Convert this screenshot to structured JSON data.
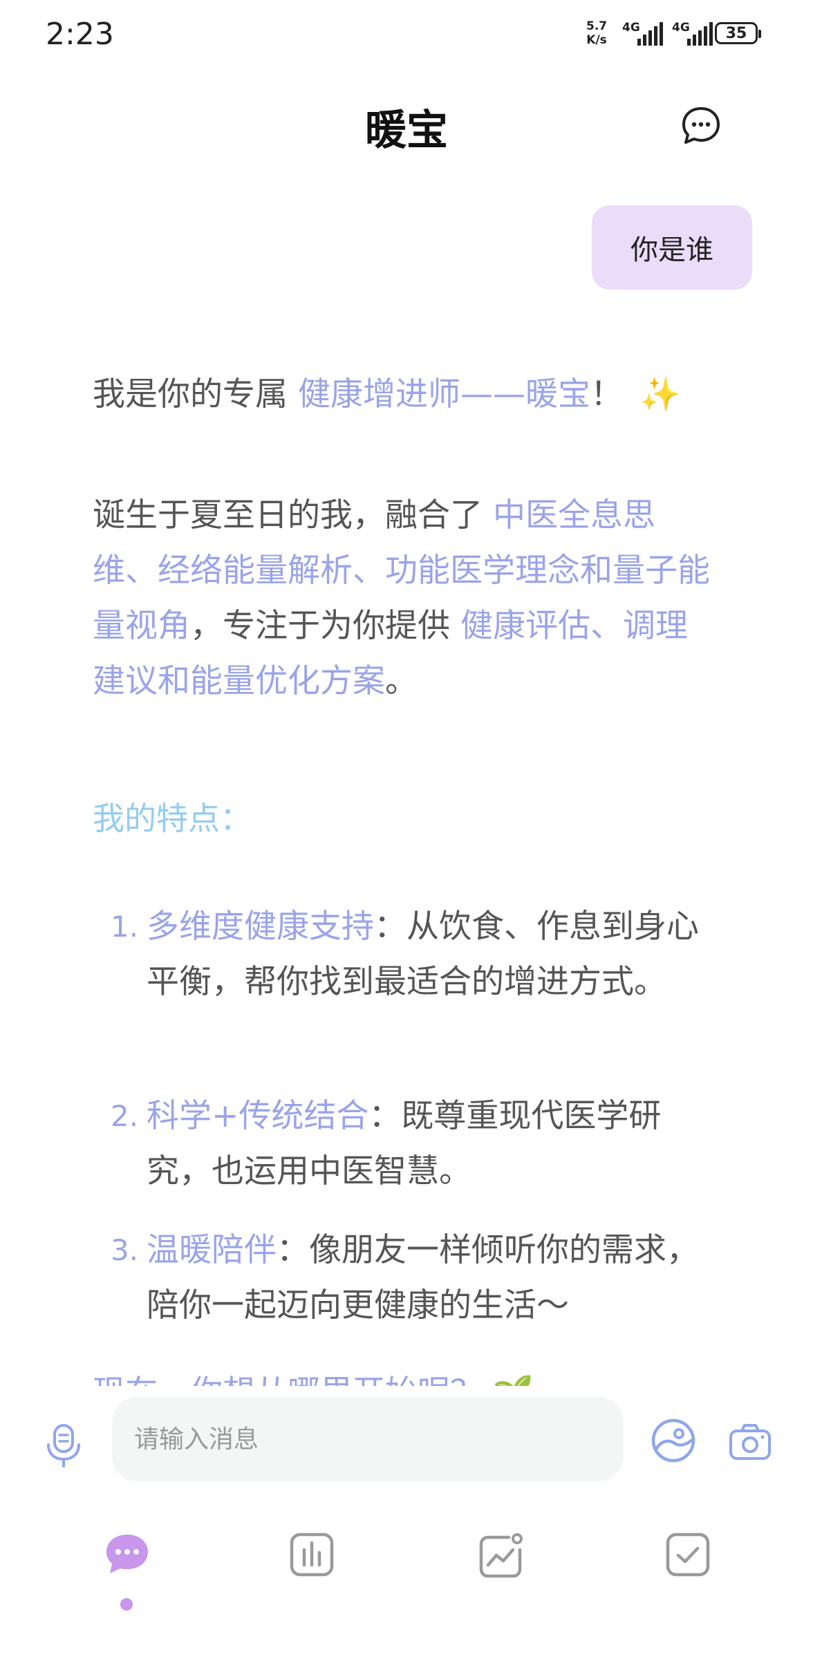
{
  "status_bar": {
    "time": "2:23",
    "net_speed_value": "5.7",
    "net_speed_unit": "K/s",
    "signal_1_label": "4G",
    "signal_2_label": "4G",
    "battery": "35"
  },
  "header": {
    "title": "暖宝",
    "chat_icon": "chat-bubble-icon"
  },
  "conversation": {
    "user_message": "你是谁",
    "assistant": {
      "intro_prefix": "我是你的专属 ",
      "intro_highlight": "健康增进师——暖宝",
      "intro_suffix": "！",
      "sparkle": "✨",
      "p2_text1": "诞生于夏至日的我，融合了 ",
      "p2_hl1": "中医全息思维、经络能量解析、功能医学理念和量子能量视角",
      "p2_text2": "，专注于为你提供 ",
      "p2_hl2": "健康评估、调理建议和能量优化方案",
      "p2_text3": "。",
      "features_title": "我的特点：",
      "features": [
        {
          "num": "1.",
          "title": "多维度健康支持",
          "sep": "：",
          "desc": "从饮食、作息到身心平衡，帮你找到最适合的增进方式。"
        },
        {
          "num": "2.",
          "title": "科学+传统结合",
          "sep": "：",
          "desc": "既尊重现代医学研究，也运用中医智慧。"
        },
        {
          "num": "3.",
          "title": "温暖陪伴",
          "sep": "：",
          "desc": "像朋友一样倾听你的需求，陪你一起迈向更健康的生活～"
        }
      ],
      "cut_line": "现在，你想从哪里开始呢？ 🌱"
    }
  },
  "input_bar": {
    "placeholder": "请输入消息",
    "icons": [
      "microphone-icon",
      "gallery-icon",
      "camera-icon"
    ]
  },
  "tab_bar": {
    "active_index": 0,
    "tabs": [
      "chat-tab-icon",
      "report-tab-icon",
      "trend-tab-icon",
      "checklist-tab-icon"
    ]
  },
  "colors": {
    "highlight": "#9aa4e8",
    "section_title": "#95ccef",
    "user_bubble": "#ebdcf9",
    "active_tab": "#c896ea",
    "icon_blue": "#8fa6ec"
  }
}
